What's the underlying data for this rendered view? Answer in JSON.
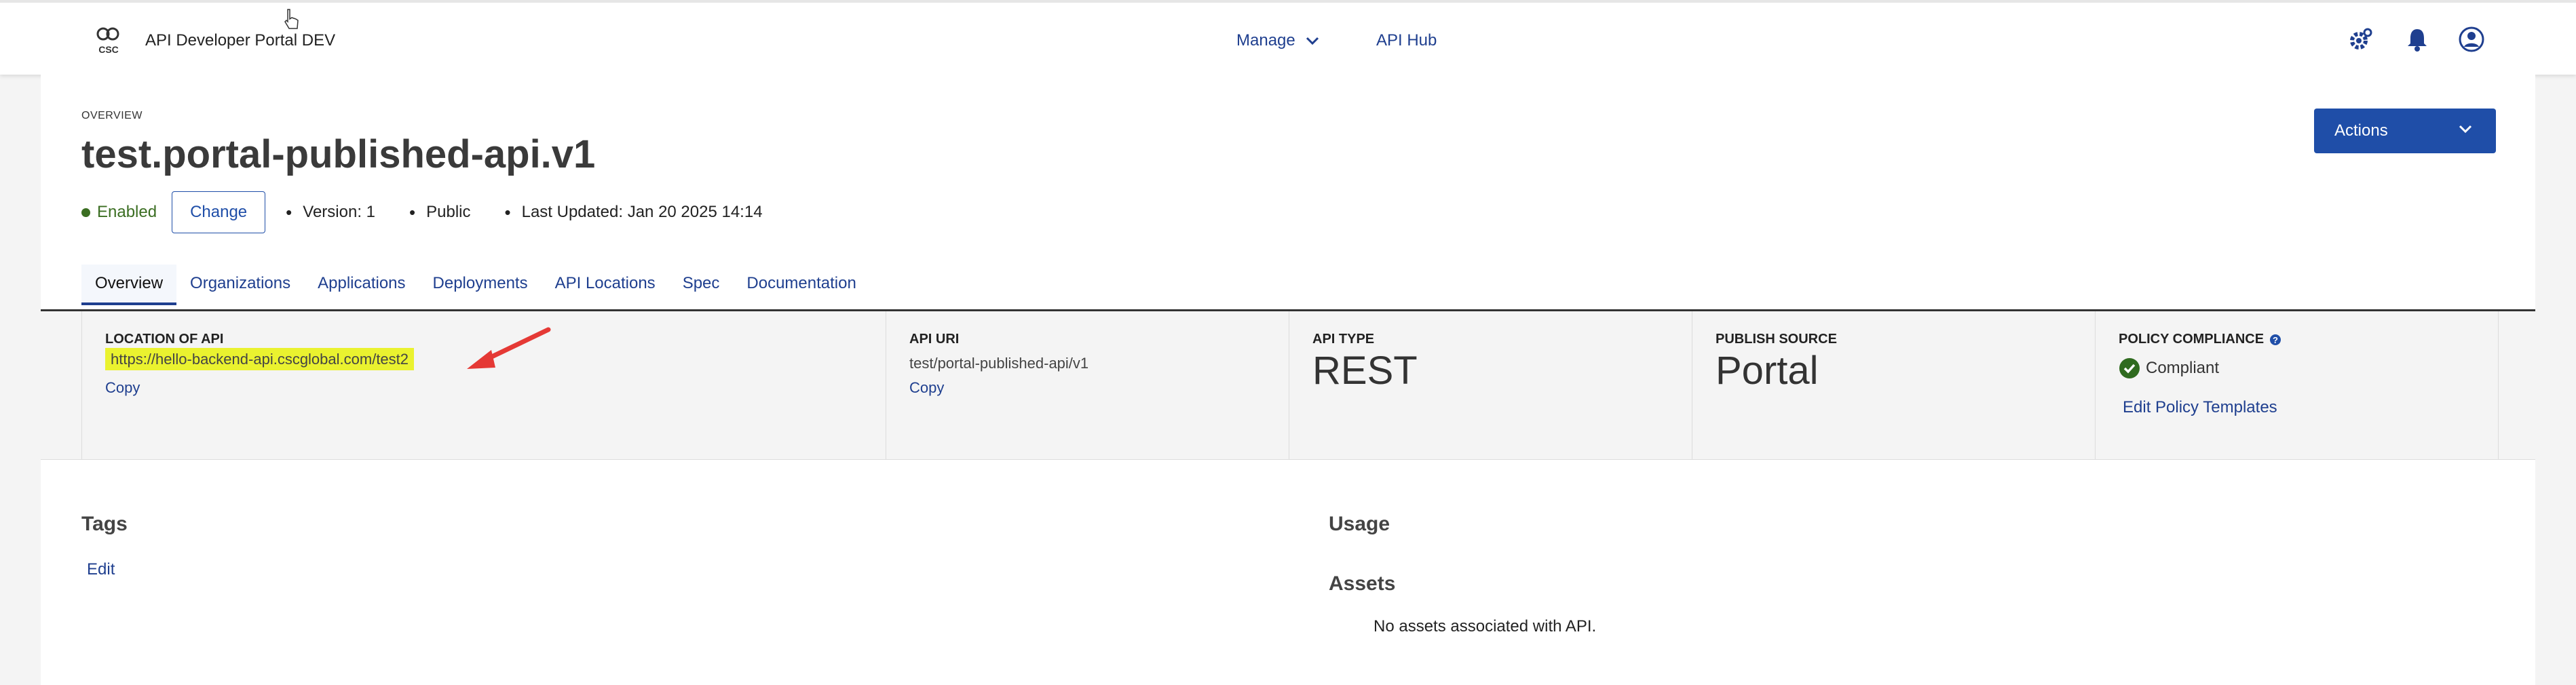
{
  "header": {
    "logo_text": "API Developer Portal DEV",
    "logo_mark": "CSC",
    "nav": {
      "manage": "Manage",
      "api_hub": "API Hub"
    },
    "icons": [
      "settings-gear-icon",
      "bell-icon",
      "user-avatar-icon"
    ]
  },
  "overview": {
    "overline": "OVERVIEW",
    "title": "test.portal-published-api.v1",
    "status": "Enabled",
    "change_label": "Change",
    "version": "Version: 1",
    "visibility": "Public",
    "last_updated": "Last Updated: Jan 20 2025 14:14",
    "actions_label": "Actions"
  },
  "tabs": [
    "Overview",
    "Organizations",
    "Applications",
    "Deployments",
    "API Locations",
    "Spec",
    "Documentation"
  ],
  "details": {
    "location": {
      "label": "LOCATION OF API",
      "value": "https://hello-backend-api.cscglobal.com/test2",
      "copy": "Copy"
    },
    "uri": {
      "label": "API URI",
      "value": "test/portal-published-api/v1",
      "copy": "Copy"
    },
    "type": {
      "label": "API TYPE",
      "value": "REST"
    },
    "source": {
      "label": "PUBLISH SOURCE",
      "value": "Portal"
    },
    "compliance": {
      "label": "POLICY COMPLIANCE",
      "status": "Compliant",
      "edit_link": "Edit Policy Templates"
    }
  },
  "tags": {
    "title": "Tags",
    "edit": "Edit"
  },
  "usage": {
    "title": "Usage"
  },
  "assets": {
    "title": "Assets",
    "empty": "No assets associated with API."
  },
  "colors": {
    "brand_blue": "#1f4ea8",
    "enabled_green": "#3b6e22",
    "highlight_yellow": "#eaf22f",
    "arrow_red": "#e53935"
  }
}
